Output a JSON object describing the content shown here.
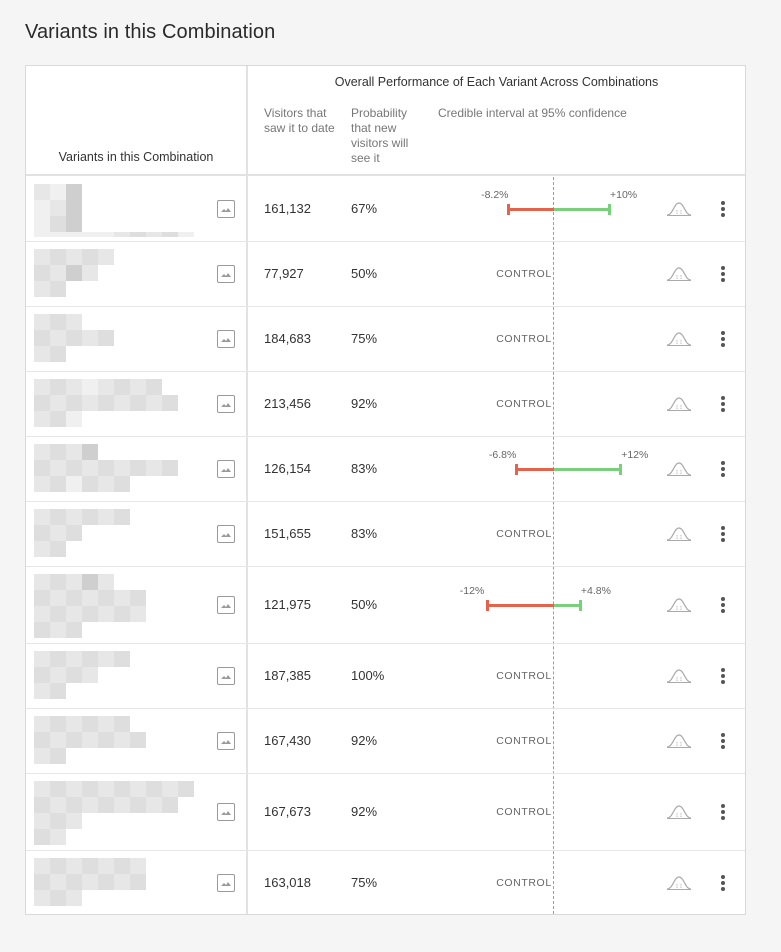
{
  "page": {
    "title": "Variants in this Combination"
  },
  "table": {
    "left_header": "Variants in this Combination",
    "group_header": "Overall Performance of Each Variant Across Combinations",
    "columns": {
      "visitors": "Visitors that saw it to date",
      "probability": "Probability that new visitors will see it",
      "interval": "Credible interval at 95% confidence"
    },
    "control_label": "CONTROL",
    "rows": [
      {
        "visitors": "161,132",
        "probability": "67%",
        "ci": {
          "low": -8.2,
          "high": 10,
          "low_label": "-8.2%",
          "high_label": "+10%"
        }
      },
      {
        "visitors": "77,927",
        "probability": "50%",
        "control": true
      },
      {
        "visitors": "184,683",
        "probability": "75%",
        "control": true
      },
      {
        "visitors": "213,456",
        "probability": "92%",
        "control": true
      },
      {
        "visitors": "126,154",
        "probability": "83%",
        "ci": {
          "low": -6.8,
          "high": 12,
          "low_label": "-6.8%",
          "high_label": "+12%"
        }
      },
      {
        "visitors": "151,655",
        "probability": "83%",
        "control": true
      },
      {
        "visitors": "121,975",
        "probability": "50%",
        "ci": {
          "low": -12,
          "high": 4.8,
          "low_label": "-12%",
          "high_label": "+4.8%"
        }
      },
      {
        "visitors": "187,385",
        "probability": "100%",
        "control": true
      },
      {
        "visitors": "167,430",
        "probability": "92%",
        "control": true
      },
      {
        "visitors": "167,673",
        "probability": "92%",
        "control": true
      },
      {
        "visitors": "163,018",
        "probability": "75%",
        "control": true
      }
    ]
  },
  "icons": {
    "thumbnail_action": "image-icon",
    "distribution": "bell-curve-icon",
    "menu": "more-vertical-icon"
  },
  "colors": {
    "negative": "#e4634d",
    "positive": "#79cf7c",
    "divider": "#e2e2e2"
  }
}
